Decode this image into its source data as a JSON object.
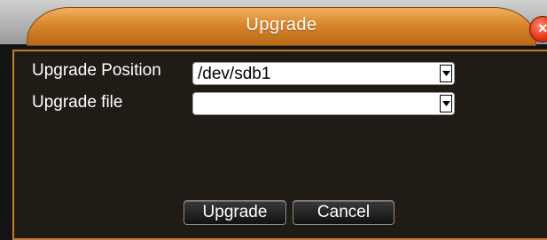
{
  "dialog": {
    "title": "Upgrade",
    "close_icon": "close-icon",
    "colors": {
      "title_tab": "#d8862a",
      "panel_border": "#c87a28",
      "panel_bg": "#211b16",
      "close_button": "#e33a1a"
    }
  },
  "form": {
    "position_label": "Upgrade Position",
    "position_value": "/dev/sdb1",
    "file_label": "Upgrade file",
    "file_value": ""
  },
  "buttons": {
    "upgrade_label": "Upgrade",
    "cancel_label": "Cancel"
  }
}
